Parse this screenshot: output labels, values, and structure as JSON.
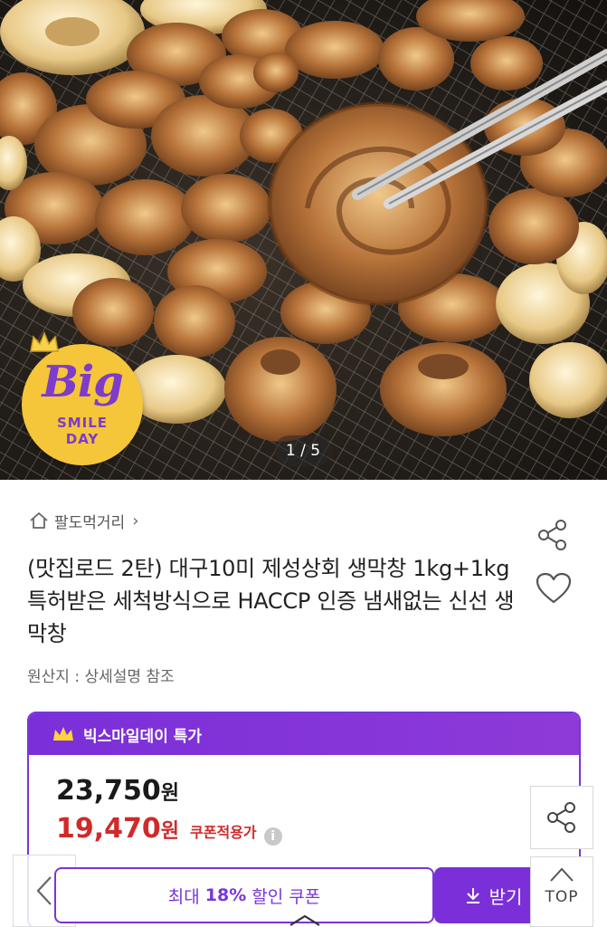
{
  "gallery": {
    "counter": "1 / 5",
    "badge": {
      "line1": "Big",
      "line2": "SMILE",
      "line3": "DAY"
    }
  },
  "product": {
    "breadcrumb": "팔도먹거리",
    "title": "(맛집로드 2탄) 대구10미 제성상회 생막창 1kg+1kg 특허받은 세척방식으로 HACCP 인증 냄새없는 신선 생막창",
    "origin": "원산지 : 상세설명 참조"
  },
  "price_card": {
    "header": "빅스마일데이 특가",
    "original_price": "23,750",
    "sale_price": "19,470",
    "currency": "원",
    "coupon_applied_label": "쿠폰적용가",
    "info_icon": "i"
  },
  "bottom_bar": {
    "coupon_prefix": "최대",
    "coupon_percent": "18%",
    "coupon_suffix": "할인 쿠폰",
    "get_label": "받기",
    "top_label": "TOP"
  },
  "colors": {
    "accent": "#7a2fd8",
    "sale": "#d02a2a",
    "badge": "#f5c53a"
  }
}
